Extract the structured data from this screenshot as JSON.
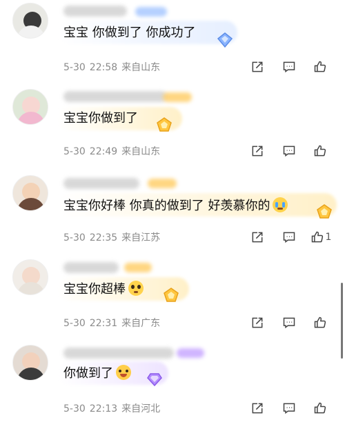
{
  "comments": [
    {
      "text": "宝宝 你做到了 你成功了",
      "date": "5-30",
      "time": "22:58",
      "location": "来自山东",
      "likes": ""
    },
    {
      "text": "宝宝你做到了",
      "date": "5-30",
      "time": "22:49",
      "location": "来自山东",
      "likes": ""
    },
    {
      "text": "宝宝你好棒 你真的做到了 好羡慕你的",
      "date": "5-30",
      "time": "22:35",
      "location": "来自江苏",
      "likes": "1"
    },
    {
      "text": "宝宝你超棒",
      "date": "5-30",
      "time": "22:31",
      "location": "来自广东",
      "likes": ""
    },
    {
      "text": "你做到了",
      "date": "5-30",
      "time": "22:13",
      "location": "来自河北",
      "likes": ""
    }
  ],
  "icons": {
    "share": "share-icon",
    "reply": "comment-icon",
    "like": "thumbs-up-icon",
    "gem_blue": "diamond-badge-icon",
    "gem_gold": "pentagon-badge-icon",
    "gem_purple": "purple-gem-icon"
  },
  "colors": {
    "meta_text": "#8a8a8a",
    "badge_blue": "#a8c8ff",
    "badge_gold": "#ffcf6b",
    "badge_purple": "#c8a8ff"
  }
}
